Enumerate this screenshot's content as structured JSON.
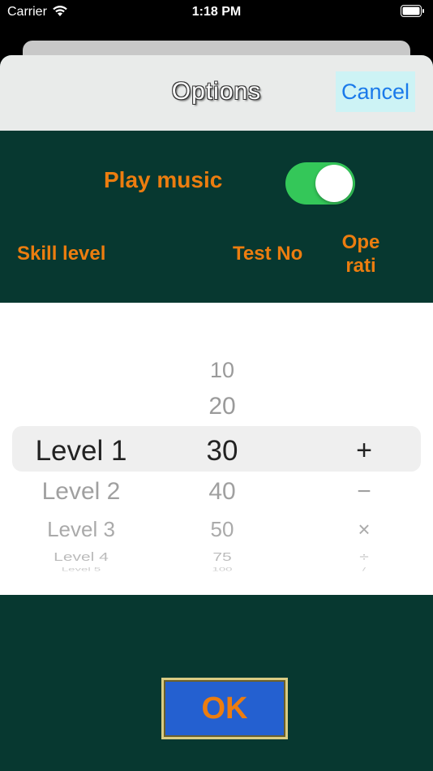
{
  "status": {
    "carrier": "Carrier",
    "time": "1:18 PM"
  },
  "nav": {
    "title": "Options",
    "cancel_label": "Cancel"
  },
  "music": {
    "label": "Play music",
    "enabled": true
  },
  "headers": {
    "skill": "Skill level",
    "test": "Test No",
    "ops_line1": "Ope",
    "ops_line2": "rati"
  },
  "picker": {
    "skill": {
      "before": [
        "",
        ""
      ],
      "selected": "Level 1",
      "after": [
        "Level 2",
        "Level 3",
        "Level 4",
        "Level 5"
      ]
    },
    "test": {
      "before": [
        "10",
        "20"
      ],
      "selected": "30",
      "after": [
        "40",
        "50",
        "75",
        "100"
      ]
    },
    "ops": {
      "before": [
        "",
        ""
      ],
      "selected": "+",
      "after": [
        "−",
        "×",
        "÷",
        "/"
      ]
    }
  },
  "ok_label": "OK",
  "colors": {
    "background": "#073830",
    "accent": "#ec7d0f",
    "toggle_on": "#34c759",
    "ok_button": "#2460d0",
    "cancel_text": "#1a7aea"
  }
}
